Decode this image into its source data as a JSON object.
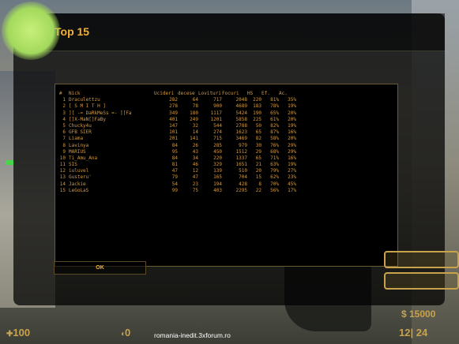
{
  "window": {
    "title": "Top 15",
    "logo_icon": "counter-terrorist-icon"
  },
  "table": {
    "headers": [
      "#",
      "Nick",
      "Ucideri",
      "decese",
      "Lovituri",
      "Focuri",
      "HS",
      "Ef.",
      "Ac."
    ],
    "rows": [
      [
        "1",
        "Draculettzu",
        "282",
        "64",
        "717",
        "2048",
        "220",
        "81%",
        "35%"
      ],
      [
        "2",
        "[ S M I T H ]",
        "278",
        "78",
        "900",
        "4689",
        "183",
        "78%",
        "19%"
      ],
      [
        "3",
        "][ -= DaRkMeSs =- ][Fa",
        "349",
        "180",
        "1117",
        "5424",
        "190",
        "65%",
        "20%"
      ],
      [
        "4",
        "[]X-MaN[]FaBy",
        "401",
        "249",
        "1201",
        "5858",
        "225",
        "61%",
        "20%"
      ],
      [
        "5",
        "Chucky4u",
        "147",
        "32",
        "544",
        "2788",
        "50",
        "82%",
        "19%"
      ],
      [
        "6",
        "GFB SIER",
        "101",
        "14",
        "274",
        "1623",
        "65",
        "87%",
        "16%"
      ],
      [
        "7",
        "Liama",
        "201",
        "141",
        "715",
        "3469",
        "82",
        "58%",
        "20%"
      ],
      [
        "8",
        "Lavinya",
        "84",
        "26",
        "285",
        "979",
        "30",
        "76%",
        "29%"
      ],
      [
        "9",
        "MARIUS",
        "95",
        "43",
        "450",
        "1512",
        "29",
        "68%",
        "29%"
      ],
      [
        "10",
        "Ti_Amu_Ana",
        "84",
        "34",
        "220",
        "1337",
        "65",
        "71%",
        "16%"
      ],
      [
        "11",
        "SIS",
        "81",
        "46",
        "329",
        "1651",
        "21",
        "63%",
        "19%"
      ],
      [
        "12",
        "iuluvel",
        "47",
        "12",
        "139",
        "510",
        "20",
        "79%",
        "27%"
      ],
      [
        "13",
        "Gusteru'",
        "79",
        "47",
        "165",
        "704",
        "15",
        "62%",
        "23%"
      ],
      [
        "14",
        "Jackie",
        "54",
        "23",
        "194",
        "428",
        "8",
        "70%",
        "45%"
      ],
      [
        "15",
        "LeGoLaS",
        "99",
        "75",
        "403",
        "2295",
        "22",
        "56%",
        "17%"
      ]
    ]
  },
  "buttons": {
    "ok_label": "OK"
  },
  "hud": {
    "health": "100",
    "armor": "0",
    "money": "$ 15000",
    "ammo": "12| 24"
  },
  "watermark": "romania-inedit.3xforum.ro",
  "colors": {
    "accent": "#f3b236",
    "table_text": "#d29a40",
    "hud": "#c9a24c"
  }
}
